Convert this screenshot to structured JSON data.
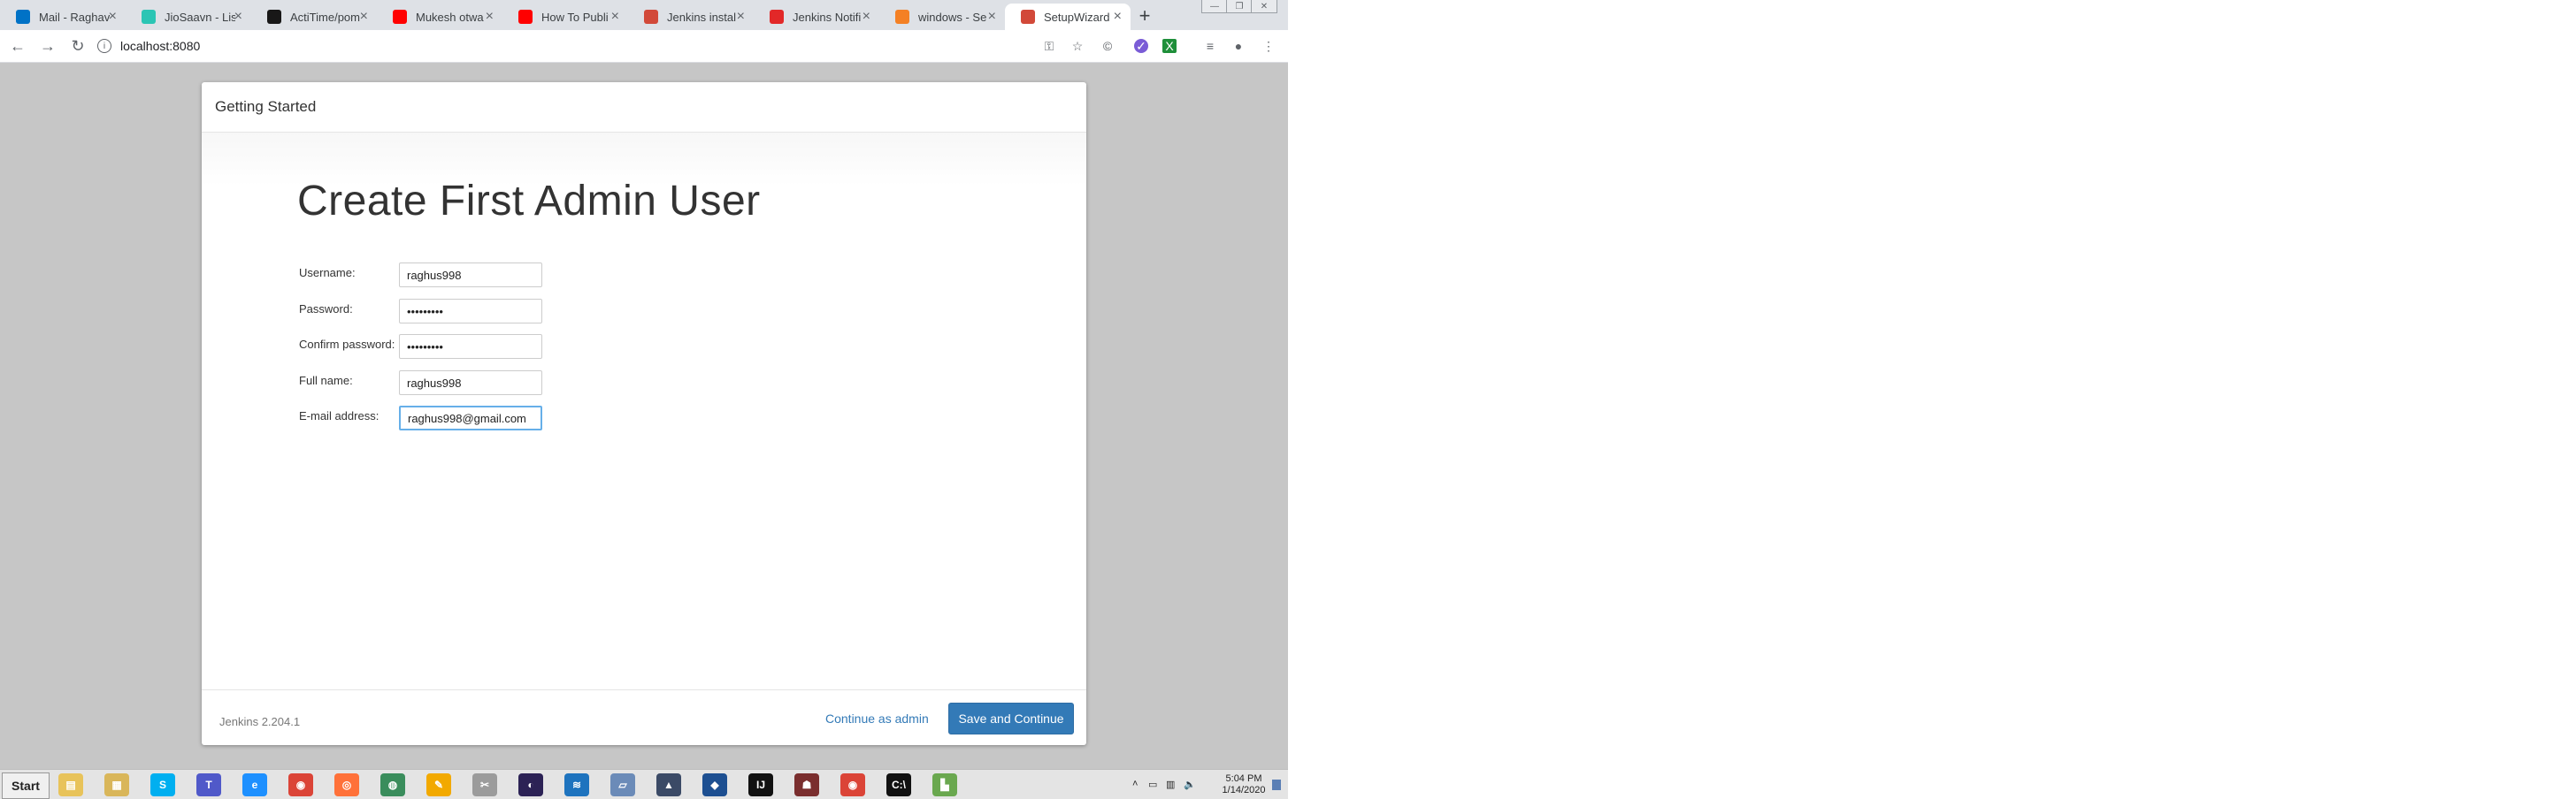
{
  "browser": {
    "tabs": [
      {
        "title": "Mail - Raghav",
        "icon": "outlook-icon",
        "color": "#0072c6"
      },
      {
        "title": "JioSaavn - Lis",
        "icon": "jiosaavn-icon",
        "color": "#2bc5b4"
      },
      {
        "title": "ActiTime/pom",
        "icon": "github-icon",
        "color": "#181717"
      },
      {
        "title": "Mukesh otwa",
        "icon": "youtube-icon",
        "color": "#ff0000"
      },
      {
        "title": "How To Publi",
        "icon": "youtube-icon",
        "color": "#ff0000"
      },
      {
        "title": "Jenkins instal",
        "icon": "jenkins-icon",
        "color": "#d24939"
      },
      {
        "title": "Jenkins Notifi",
        "icon": "vivaldi-icon",
        "color": "#e22828"
      },
      {
        "title": "windows - Se",
        "icon": "stackoverflow-icon",
        "color": "#f48024"
      },
      {
        "title": "SetupWizard",
        "icon": "jenkins-icon",
        "color": "#d24939",
        "active": true
      }
    ],
    "new_tab": "+",
    "url": "localhost:8080"
  },
  "page": {
    "header": "Getting Started",
    "form_title": "Create First Admin User",
    "fields": [
      {
        "label": "Username:",
        "value": "raghus998",
        "type": "text"
      },
      {
        "label": "Password:",
        "value": "•••••••••",
        "type": "password"
      },
      {
        "label": "Confirm password:",
        "value": "•••••••••",
        "type": "password"
      },
      {
        "label": "Full name:",
        "value": "raghus998",
        "type": "text"
      },
      {
        "label": "E-mail address:",
        "value": "raghus998@gmail.com",
        "type": "email",
        "focused": true
      }
    ],
    "version": "Jenkins 2.204.1",
    "continue_admin": "Continue as admin",
    "save_continue": "Save and Continue",
    "accent_color": "#337ab7"
  },
  "taskbar": {
    "start": "Start",
    "time": "5:04 PM",
    "date": "1/14/2020"
  }
}
